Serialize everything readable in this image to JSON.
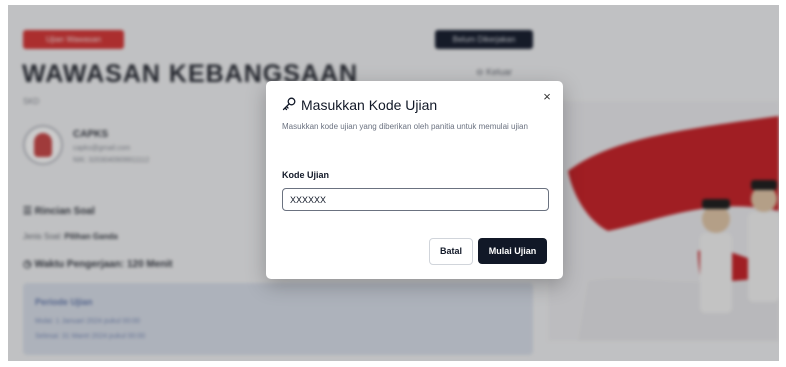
{
  "colors": {
    "accent_red": "#d63a3a",
    "dark": "#111827",
    "muted_text": "#6b7280"
  },
  "background": {
    "header_badge": "Ujian Wawasan",
    "status_button": "Belum Dikerjakan",
    "title": "WAWASAN KEBANGSAAN",
    "subtitle": "SKD",
    "logout_label": "Keluar",
    "user": {
      "name": "CAPKS",
      "email": "capks@gmail.com",
      "nik": "NIK: 3203040909911112"
    },
    "details_label": "Rincian Soal",
    "question_type_label": "Jenis Soal:",
    "question_type_value": "Pilihan Ganda",
    "duration_label": "Waktu Pengerjaan: 120 Menit",
    "period": {
      "title": "Periode Ujian",
      "start": "Mulai: 1 Januari 2024 pukul 00:00",
      "end": "Selesai: 31 Maret 2024 pukul 00:00"
    },
    "icons": [
      "list-icon",
      "clock-icon",
      "logout-icon"
    ]
  },
  "modal": {
    "icon": "key-icon",
    "title": "Masukkan Kode Ujian",
    "description": "Masukkan kode ujian yang diberikan oleh panitia untuk memulai ujian",
    "field_label": "Kode Ujian",
    "field_value": "XXXXXX",
    "close_label": "×",
    "cancel_label": "Batal",
    "submit_label": "Mulai Ujian"
  }
}
